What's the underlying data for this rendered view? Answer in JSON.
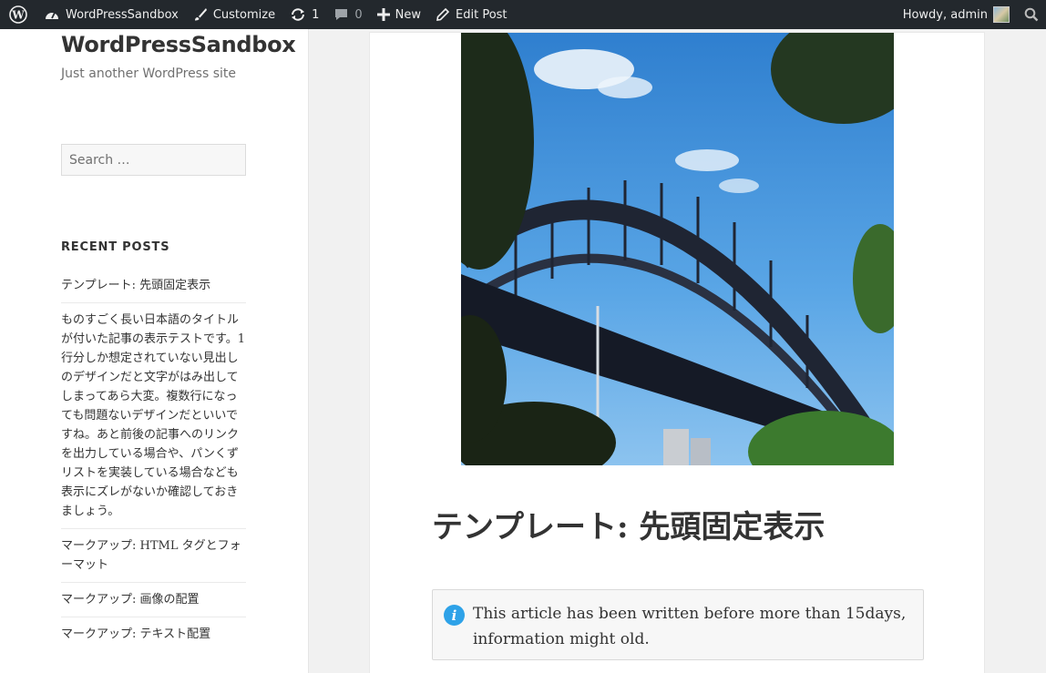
{
  "admin_bar": {
    "site_name": "WordPressSandbox",
    "customize": "Customize",
    "updates_count": "1",
    "comments_count": "0",
    "new_label": "New",
    "edit_post": "Edit Post",
    "howdy": "Howdy, admin"
  },
  "sidebar": {
    "site_title": "WordPressSandbox",
    "site_description": "Just another WordPress site",
    "search_placeholder": "Search …",
    "recent_posts_title": "RECENT POSTS",
    "recent_posts": [
      "テンプレート: 先頭固定表示",
      "ものすごく長い日本語のタイトルが付いた記事の表示テストです。1行分しか想定されていない見出しのデザインだと文字がはみ出してしまってあら大変。複数行になっても問題ないデザインだといいですね。あと前後の記事へのリンクを出力している場合や、パンくずリストを実装している場合なども表示にズレがないか確認しておきましょう。",
      "マークアップ: HTML タグとフォーマット",
      "マークアップ: 画像の配置",
      "マークアップ: テキスト配置"
    ]
  },
  "article": {
    "title": "テンプレート: 先頭固定表示",
    "notice": "This article has been written before more than 15days, information might old."
  },
  "colors": {
    "admin_bar_bg": "#23282d",
    "page_bg": "#f1f1f1",
    "info_icon": "#2ea2e8",
    "sky": "#3d8fd8"
  }
}
